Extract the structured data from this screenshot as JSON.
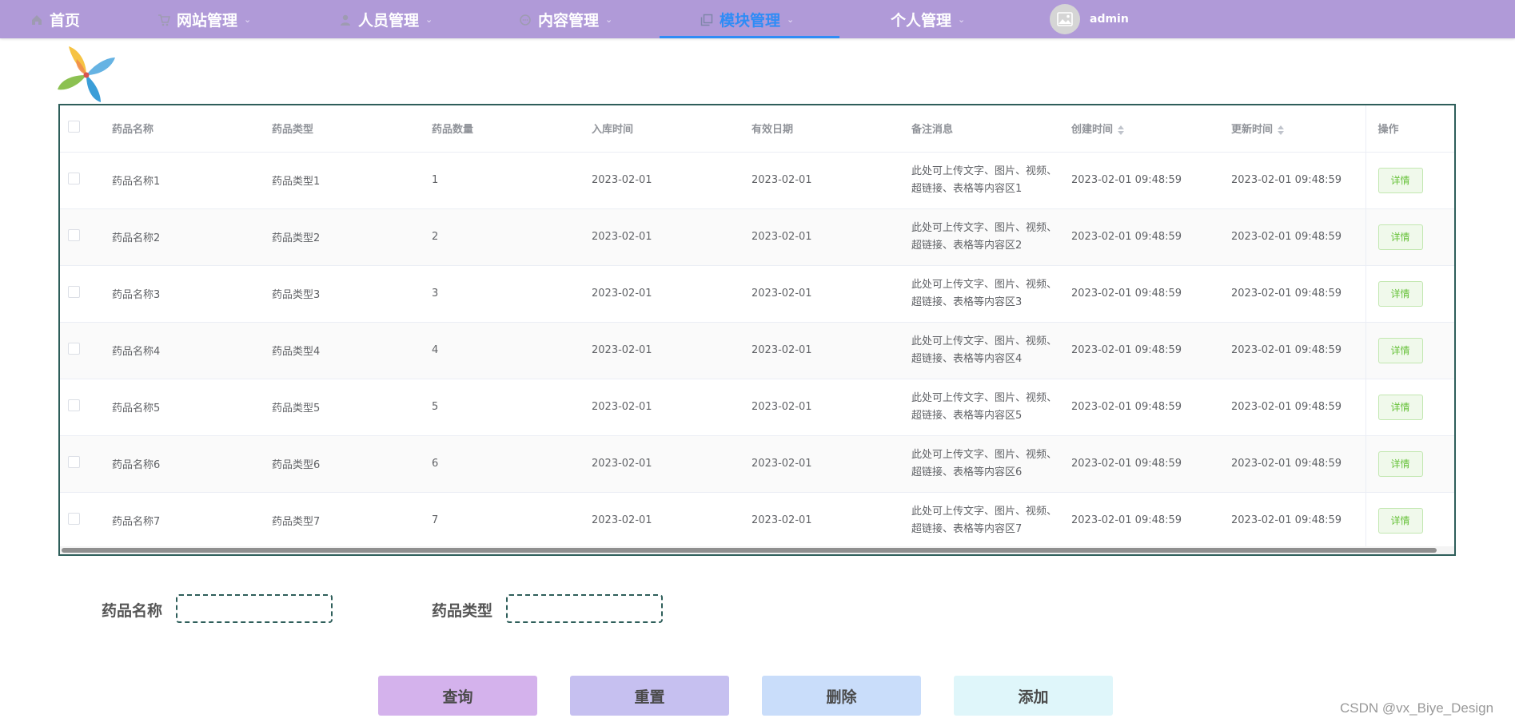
{
  "nav": {
    "items": [
      {
        "label": "首页",
        "icon": "home-icon",
        "has_dropdown": false
      },
      {
        "label": "网站管理",
        "icon": "cart-icon",
        "has_dropdown": true
      },
      {
        "label": "人员管理",
        "icon": "user-icon",
        "has_dropdown": true
      },
      {
        "label": "内容管理",
        "icon": "chat-icon",
        "has_dropdown": true
      },
      {
        "label": "模块管理",
        "icon": "copy-icon",
        "has_dropdown": true,
        "active": true
      },
      {
        "label": "个人管理",
        "icon": "",
        "has_dropdown": true
      }
    ],
    "user": {
      "name": "admin",
      "avatar_icon": "image-icon"
    },
    "active_color": "#2f8cf6",
    "background_color": "#b09ad8"
  },
  "table": {
    "columns": [
      "药品名称",
      "药品类型",
      "药品数量",
      "入库时间",
      "有效日期",
      "备注消息",
      "创建时间",
      "更新时间",
      "操作"
    ],
    "rows": [
      {
        "name": "药品名称1",
        "type": "药品类型1",
        "qty": "1",
        "in_date": "2023-02-01",
        "valid_date": "2023-02-01",
        "note": "此处可上传文字、图片、视频、超链接、表格等内容区1",
        "created": "2023-02-01 09:48:59",
        "updated": "2023-02-01 09:48:59",
        "action": "详情"
      },
      {
        "name": "药品名称2",
        "type": "药品类型2",
        "qty": "2",
        "in_date": "2023-02-01",
        "valid_date": "2023-02-01",
        "note": "此处可上传文字、图片、视频、超链接、表格等内容区2",
        "created": "2023-02-01 09:48:59",
        "updated": "2023-02-01 09:48:59",
        "action": "详情"
      },
      {
        "name": "药品名称3",
        "type": "药品类型3",
        "qty": "3",
        "in_date": "2023-02-01",
        "valid_date": "2023-02-01",
        "note": "此处可上传文字、图片、视频、超链接、表格等内容区3",
        "created": "2023-02-01 09:48:59",
        "updated": "2023-02-01 09:48:59",
        "action": "详情"
      },
      {
        "name": "药品名称4",
        "type": "药品类型4",
        "qty": "4",
        "in_date": "2023-02-01",
        "valid_date": "2023-02-01",
        "note": "此处可上传文字、图片、视频、超链接、表格等内容区4",
        "created": "2023-02-01 09:48:59",
        "updated": "2023-02-01 09:48:59",
        "action": "详情"
      },
      {
        "name": "药品名称5",
        "type": "药品类型5",
        "qty": "5",
        "in_date": "2023-02-01",
        "valid_date": "2023-02-01",
        "note": "此处可上传文字、图片、视频、超链接、表格等内容区5",
        "created": "2023-02-01 09:48:59",
        "updated": "2023-02-01 09:48:59",
        "action": "详情"
      },
      {
        "name": "药品名称6",
        "type": "药品类型6",
        "qty": "6",
        "in_date": "2023-02-01",
        "valid_date": "2023-02-01",
        "note": "此处可上传文字、图片、视频、超链接、表格等内容区6",
        "created": "2023-02-01 09:48:59",
        "updated": "2023-02-01 09:48:59",
        "action": "详情"
      },
      {
        "name": "药品名称7",
        "type": "药品类型7",
        "qty": "7",
        "in_date": "2023-02-01",
        "valid_date": "2023-02-01",
        "note": "此处可上传文字、图片、视频、超链接、表格等内容区7",
        "created": "2023-02-01 09:48:59",
        "updated": "2023-02-01 09:48:59",
        "action": "详情"
      }
    ]
  },
  "search": {
    "name_label": "药品名称",
    "name_value": "",
    "type_label": "药品类型",
    "type_value": ""
  },
  "actions": [
    {
      "label": "查询",
      "color": "#d4b2ec"
    },
    {
      "label": "重置",
      "color": "#c6c0f0"
    },
    {
      "label": "删除",
      "color": "#c9ddfa"
    },
    {
      "label": "添加",
      "color": "#dff6fa"
    }
  ],
  "watermark": "CSDN @vx_Biye_Design"
}
